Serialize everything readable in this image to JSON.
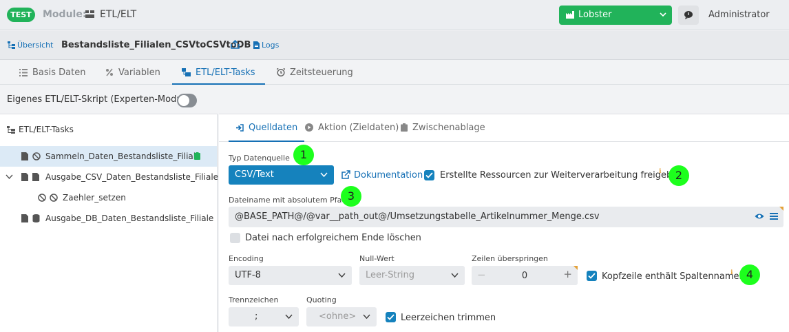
{
  "header": {
    "badge": "TEST",
    "module_label": "Module:",
    "module_name": "ETL/ELT",
    "tenant": "Lobster",
    "user": "Administrator"
  },
  "breadcrumb": {
    "overview": "Übersicht",
    "title": "Bestandsliste_Filialen_CSVtoCSVtoDB",
    "logs": "Logs"
  },
  "main_tabs": [
    "Basis Daten",
    "Variablen",
    "ETL/ELT-Tasks",
    "Zeitsteuerung"
  ],
  "expert_mode": {
    "label": "Eigenes ETL/ELT-Skript (Experten-Modus)",
    "enabled": false
  },
  "tree": {
    "header": "ETL/ELT-Tasks",
    "items": [
      "Sammeln_Daten_Bestandsliste_Filiale",
      "Ausgabe_CSV_Daten_Bestandsliste_Filiale",
      "Zaehler_setzen",
      "Ausgabe_DB_Daten_Bestandsliste_Filiale"
    ]
  },
  "sub_tabs": [
    "Quelldaten",
    "Aktion (Zieldaten)",
    "Zwischenablage"
  ],
  "form": {
    "source_type_label": "Typ Datenquelle",
    "source_type_value": "CSV/Text",
    "documentation_link": "Dokumentation",
    "share_resources_label": "Erstellte Ressourcen zur Weiterverarbeitung freigeben",
    "share_resources_checked": true,
    "filename_label": "Dateiname mit absolutem Pfad",
    "filename_value": "@BASE_PATH@/@var__path_out@/Umsetzungstabelle_Artikelnummer_Menge.csv",
    "delete_after_label": "Datei nach erfolgreichem Ende löschen",
    "delete_after_checked": false,
    "encoding_label": "Encoding",
    "encoding_value": "UTF-8",
    "null_label": "Null-Wert",
    "null_value": "Leer-String",
    "skip_rows_label": "Zeilen überspringen",
    "skip_rows_value": "0",
    "header_row_label": "Kopfzeile enthält Spaltennamen",
    "header_row_checked": true,
    "separator_label": "Trennzeichen",
    "separator_value": ";",
    "quoting_label": "Quoting",
    "quoting_value": "<ohne>",
    "trim_label": "Leerzeichen trimmen",
    "trim_checked": true
  },
  "callouts": [
    "1",
    "2",
    "3",
    "4"
  ],
  "colors": {
    "accent": "#1670b5",
    "primary_select": "#1582bd",
    "success": "#21b35a",
    "callout": "#1dff1d",
    "info": "#e4a23a"
  }
}
